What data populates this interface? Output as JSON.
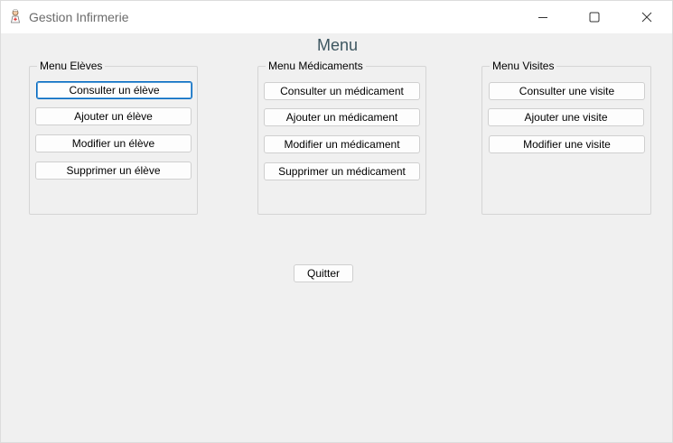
{
  "window": {
    "title": "Gestion Infirmerie",
    "icon": "nurse-app-icon",
    "controls": [
      "minimize-icon",
      "maximize-icon",
      "close-icon"
    ]
  },
  "menu_title": "Menu",
  "groups": [
    {
      "label": "Menu Elèves",
      "buttons": [
        "Consulter un élève",
        "Ajouter un élève",
        "Modifier un élève",
        "Supprimer un élève"
      ]
    },
    {
      "label": "Menu Médicaments",
      "buttons": [
        "Consulter un médicament",
        "Ajouter un médicament",
        "Modifier un médicament",
        "Supprimer un médicament"
      ]
    },
    {
      "label": "Menu Visites",
      "buttons": [
        "Consulter une visite",
        "Ajouter une visite",
        "Modifier une visite"
      ]
    }
  ],
  "quit_label": "Quitter",
  "colors": {
    "background": "#f0f0f0",
    "titlebar": "#ffffff",
    "title_text": "#3d5660",
    "focus_border": "#0067c0"
  }
}
